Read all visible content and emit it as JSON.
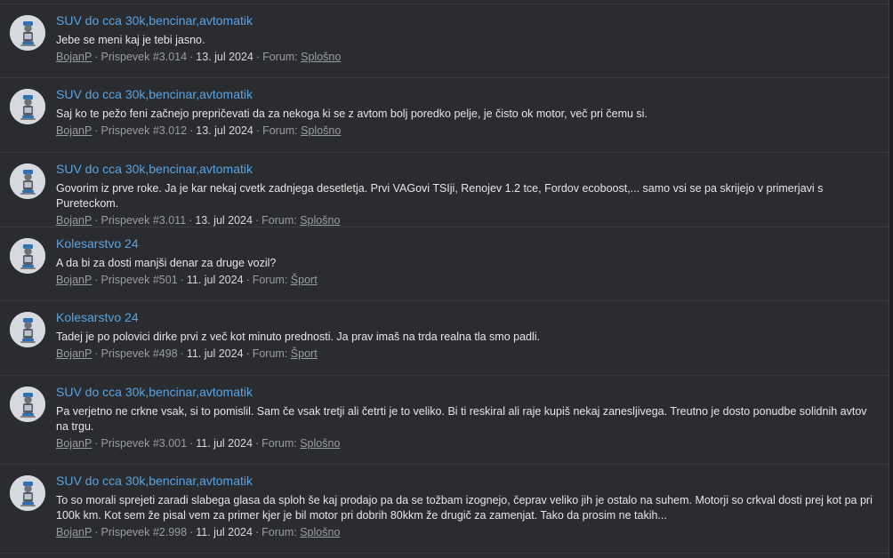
{
  "results": [
    {
      "title": "SUV do cca 30k,bencinar,avtomatik",
      "snippet": "Jebe se meni kaj je tebi jasno.",
      "user": "BojanP",
      "post": "Prispevek #3.014",
      "date": "13. jul 2024",
      "forum_label": "Forum:",
      "forum": "Splošno"
    },
    {
      "title": "SUV do cca 30k,bencinar,avtomatik",
      "snippet": "Saj ko te pežo feni začnejo prepričevati da za nekoga ki se z avtom bolj poredko pelje, je čisto ok motor, več pri čemu si.",
      "user": "BojanP",
      "post": "Prispevek #3.012",
      "date": "13. jul 2024",
      "forum_label": "Forum:",
      "forum": "Splošno"
    },
    {
      "title": "SUV do cca 30k,bencinar,avtomatik",
      "snippet": "Govorim iz prve roke. Ja je kar nekaj cvetk zadnjega desetletja. Prvi VAGovi TSIji, Renojev 1.2 tce, Fordov ecoboost,... samo vsi se pa skrijejo v primerjavi s Pureteckom.",
      "user": "BojanP",
      "post": "Prispevek #3.011",
      "date": "13. jul 2024",
      "forum_label": "Forum:",
      "forum": "Splošno"
    },
    {
      "title": "Kolesarstvo 24",
      "snippet": "A da bi za dosti manjši denar za druge vozil?",
      "user": "BojanP",
      "post": "Prispevek #501",
      "date": "11. jul 2024",
      "forum_label": "Forum:",
      "forum": "Šport"
    },
    {
      "title": "Kolesarstvo 24",
      "snippet": "Tadej je po polovici dirke prvi z več kot minuto prednosti. Ja prav imaš na trda realna tla smo padli.",
      "user": "BojanP",
      "post": "Prispevek #498",
      "date": "11. jul 2024",
      "forum_label": "Forum:",
      "forum": "Šport"
    },
    {
      "title": "SUV do cca 30k,bencinar,avtomatik",
      "snippet": "Pa verjetno ne crkne vsak, si to pomislil. Sam če vsak tretji ali četrti je to veliko. Bi ti reskiral ali raje kupiš nekaj zanesljivega. Treutno je dosto ponudbe solidnih avtov na trgu.",
      "user": "BojanP",
      "post": "Prispevek #3.001",
      "date": "11. jul 2024",
      "forum_label": "Forum:",
      "forum": "Splošno"
    },
    {
      "title": "SUV do cca 30k,bencinar,avtomatik",
      "snippet": "To so morali sprejeti zaradi slabega glasa da sploh še kaj prodajo pa da se tožbam izognejo, čeprav veliko jih je ostalo na suhem. Motorji so crkval dosti prej kot pa pri 100k km. Kot sem že pisal vem za primer kjer je bil motor pri dobrih 80kkm že drugič za zamenjat. Tako da prosim ne takih...",
      "user": "BojanP",
      "post": "Prispevek #2.998",
      "date": "11. jul 2024",
      "forum_label": "Forum:",
      "forum": "Splošno"
    }
  ],
  "colors": {
    "page_bg": "#1d1e20",
    "panel_bg": "#2b2c30",
    "link": "#5aa3e0",
    "text": "#e6e6e6",
    "muted": "#9a9ca3"
  }
}
